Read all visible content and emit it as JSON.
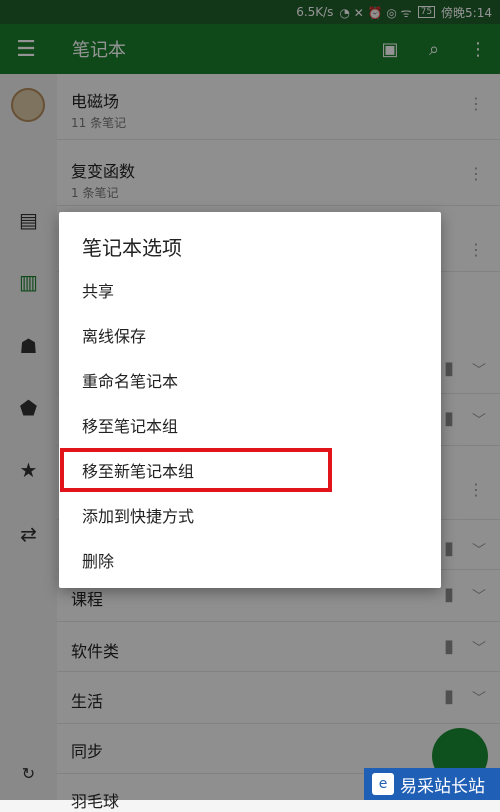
{
  "status": {
    "speed": "6.5K/s",
    "battery": "75",
    "time": "傍晚5:14"
  },
  "appbar": {
    "title": "笔记本"
  },
  "notebooks": [
    {
      "name": "电磁场",
      "count": "11 条笔记"
    },
    {
      "name": "复变函数",
      "count": "1 条笔记"
    },
    {
      "name": "课程"
    },
    {
      "name": "软件类"
    },
    {
      "name": "生活"
    },
    {
      "name": "同步"
    },
    {
      "name": "羽毛球"
    }
  ],
  "dialog": {
    "title": "笔记本选项",
    "items": [
      "共享",
      "离线保存",
      "重命名笔记本",
      "移至笔记本组",
      "移至新笔记本组",
      "添加到快捷方式",
      "删除"
    ]
  },
  "watermark": {
    "text": "易采站长站"
  },
  "icons": [
    "hamburger-menu-icon",
    "notebook-add-icon",
    "search-icon",
    "more-vert-icon",
    "notes-icon",
    "notebooks-icon",
    "shared-icon",
    "tag-icon",
    "star-icon",
    "work-chat-icon",
    "sync-icon"
  ]
}
